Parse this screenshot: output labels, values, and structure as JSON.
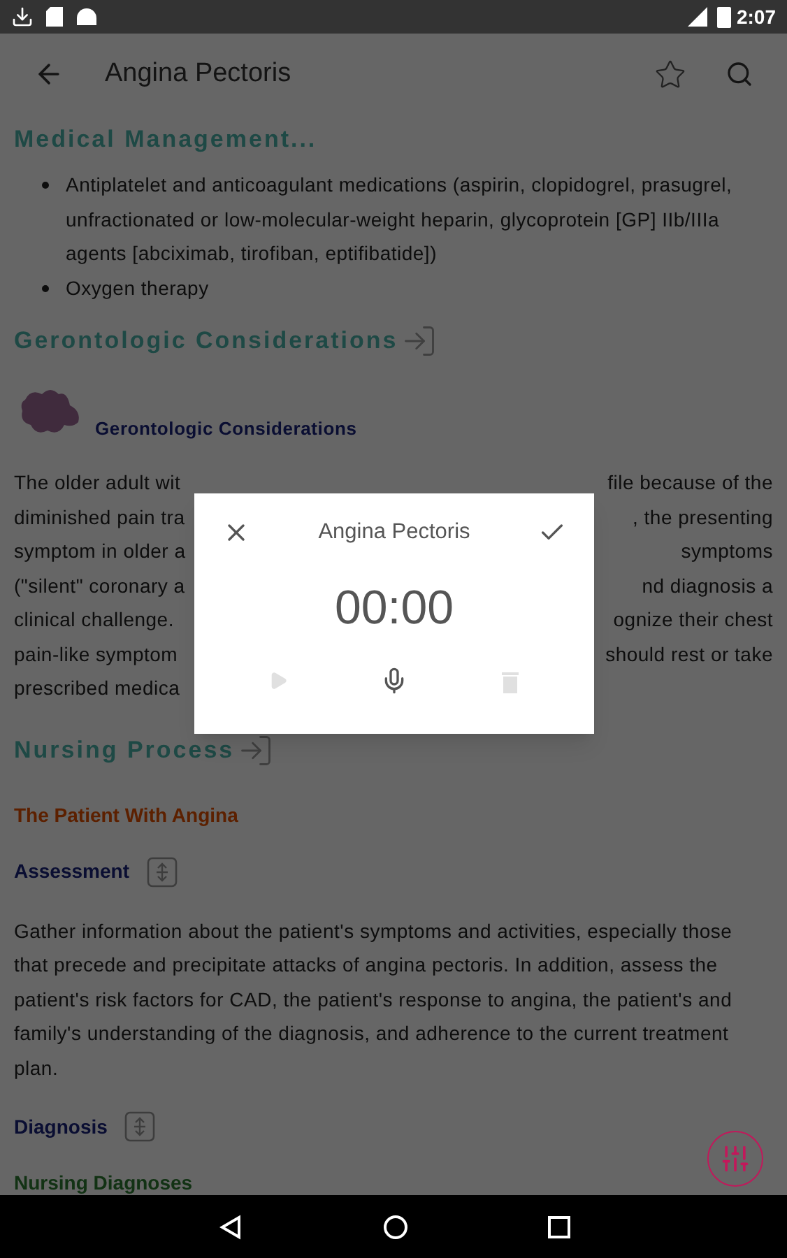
{
  "status_bar": {
    "time": "2:07"
  },
  "app_bar": {
    "title": "Angina Pectoris",
    "favorite": false
  },
  "content": [
    {
      "kind": "section",
      "text": "Medical Management...",
      "link": false
    },
    {
      "kind": "bullets",
      "items": [
        "Antiplatelet and anticoagulant medications (aspirin, clopidogrel, prasugrel, unfractionated or low-molecular-weight heparin, glycoprotein [GP] IIb/IIIa agents [abciximab, tirofiban, eptifibatide])",
        "Oxygen therapy"
      ]
    },
    {
      "kind": "section",
      "text": "Gerontologic Considerations",
      "link": true
    },
    {
      "kind": "feature",
      "text": "Gerontologic Considerations"
    },
    {
      "kind": "covered",
      "lines": [
        {
          "left": "The older adult wit",
          "right": "file because of the"
        },
        {
          "left": "diminished pain tra",
          "right": ", the presenting"
        },
        {
          "left": "symptom in older a",
          "right": "symptoms"
        },
        {
          "left": "(\"silent\" coronary a",
          "right": "nd diagnosis a"
        },
        {
          "left": "clinical challenge.",
          "right": "ognize their chest"
        },
        {
          "left": "pain-like symptom",
          "right": "should rest or take"
        },
        {
          "left": "prescribed medica"
        }
      ]
    },
    {
      "kind": "section",
      "text": "Nursing Process",
      "link": true
    },
    {
      "kind": "topic",
      "text": "The Patient With Angina"
    },
    {
      "kind": "label",
      "text": "Assessment"
    },
    {
      "kind": "paragraph",
      "text": "Gather information about the patient's symptoms and activities, especially those that precede and precipitate attacks of angina pectoris. In addition, assess the patient's risk factors for CAD, the patient's response to angina, the patient's and family's understanding of the diagnosis, and adherence to the current treatment plan."
    },
    {
      "kind": "label",
      "text": "Diagnosis"
    },
    {
      "kind": "subtopic",
      "text": "Nursing Diagnoses"
    }
  ],
  "dialog": {
    "title": "Angina Pectoris",
    "timer": "00:00",
    "play_disabled": true,
    "delete_disabled": true
  }
}
